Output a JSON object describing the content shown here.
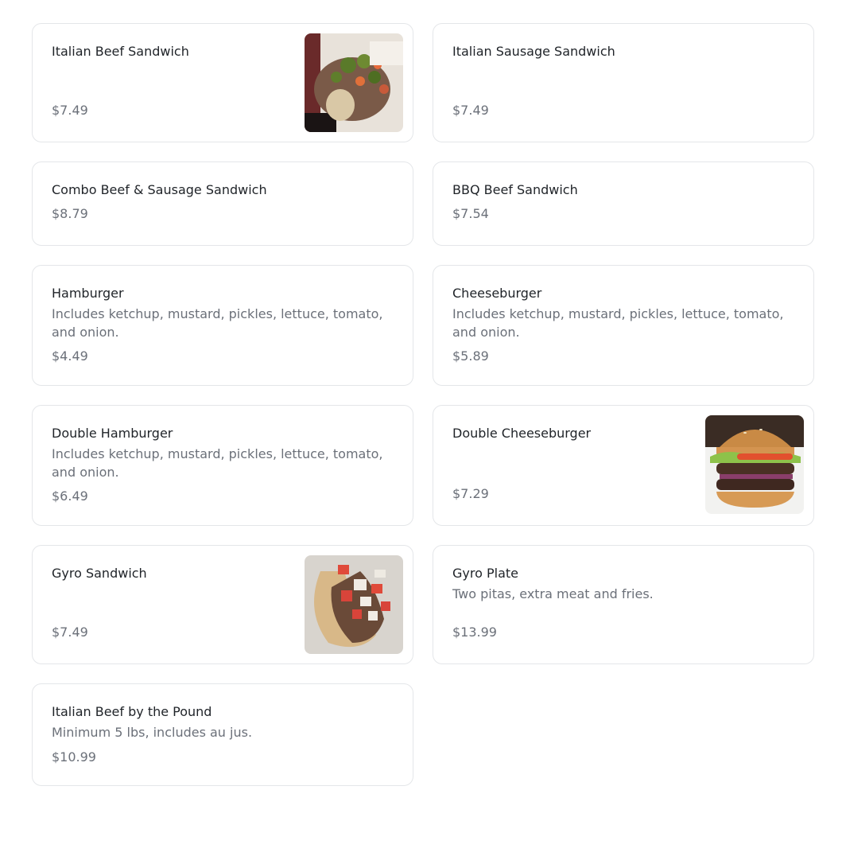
{
  "menu": {
    "items": [
      {
        "name": "Italian Beef Sandwich",
        "description": "",
        "price": "$7.49",
        "image": "italian-beef-photo"
      },
      {
        "name": "Italian Sausage Sandwich",
        "description": "",
        "price": "$7.49"
      },
      {
        "name": "Combo Beef & Sausage Sandwich",
        "description": "",
        "price": "$8.79"
      },
      {
        "name": "BBQ Beef Sandwich",
        "description": "",
        "price": "$7.54"
      },
      {
        "name": "Hamburger",
        "description": "Includes ketchup, mustard, pickles, lettuce, tomato, and onion.",
        "price": "$4.49"
      },
      {
        "name": "Cheeseburger",
        "description": "Includes ketchup, mustard, pickles, lettuce, tomato, and onion.",
        "price": "$5.89"
      },
      {
        "name": "Double Hamburger",
        "description": "Includes ketchup, mustard, pickles, lettuce, tomato, and onion.",
        "price": "$6.49"
      },
      {
        "name": "Double Cheeseburger",
        "description": "",
        "price": "$7.29",
        "image": "double-cheeseburger-photo"
      },
      {
        "name": "Gyro Sandwich",
        "description": "",
        "price": "$7.49",
        "image": "gyro-sandwich-photo"
      },
      {
        "name": "Gyro Plate",
        "description": "Two pitas, extra meat and fries.",
        "price": "$13.99"
      },
      {
        "name": "Italian Beef by the Pound",
        "description": "Minimum 5 lbs, includes au jus.",
        "price": "$10.99"
      }
    ]
  }
}
